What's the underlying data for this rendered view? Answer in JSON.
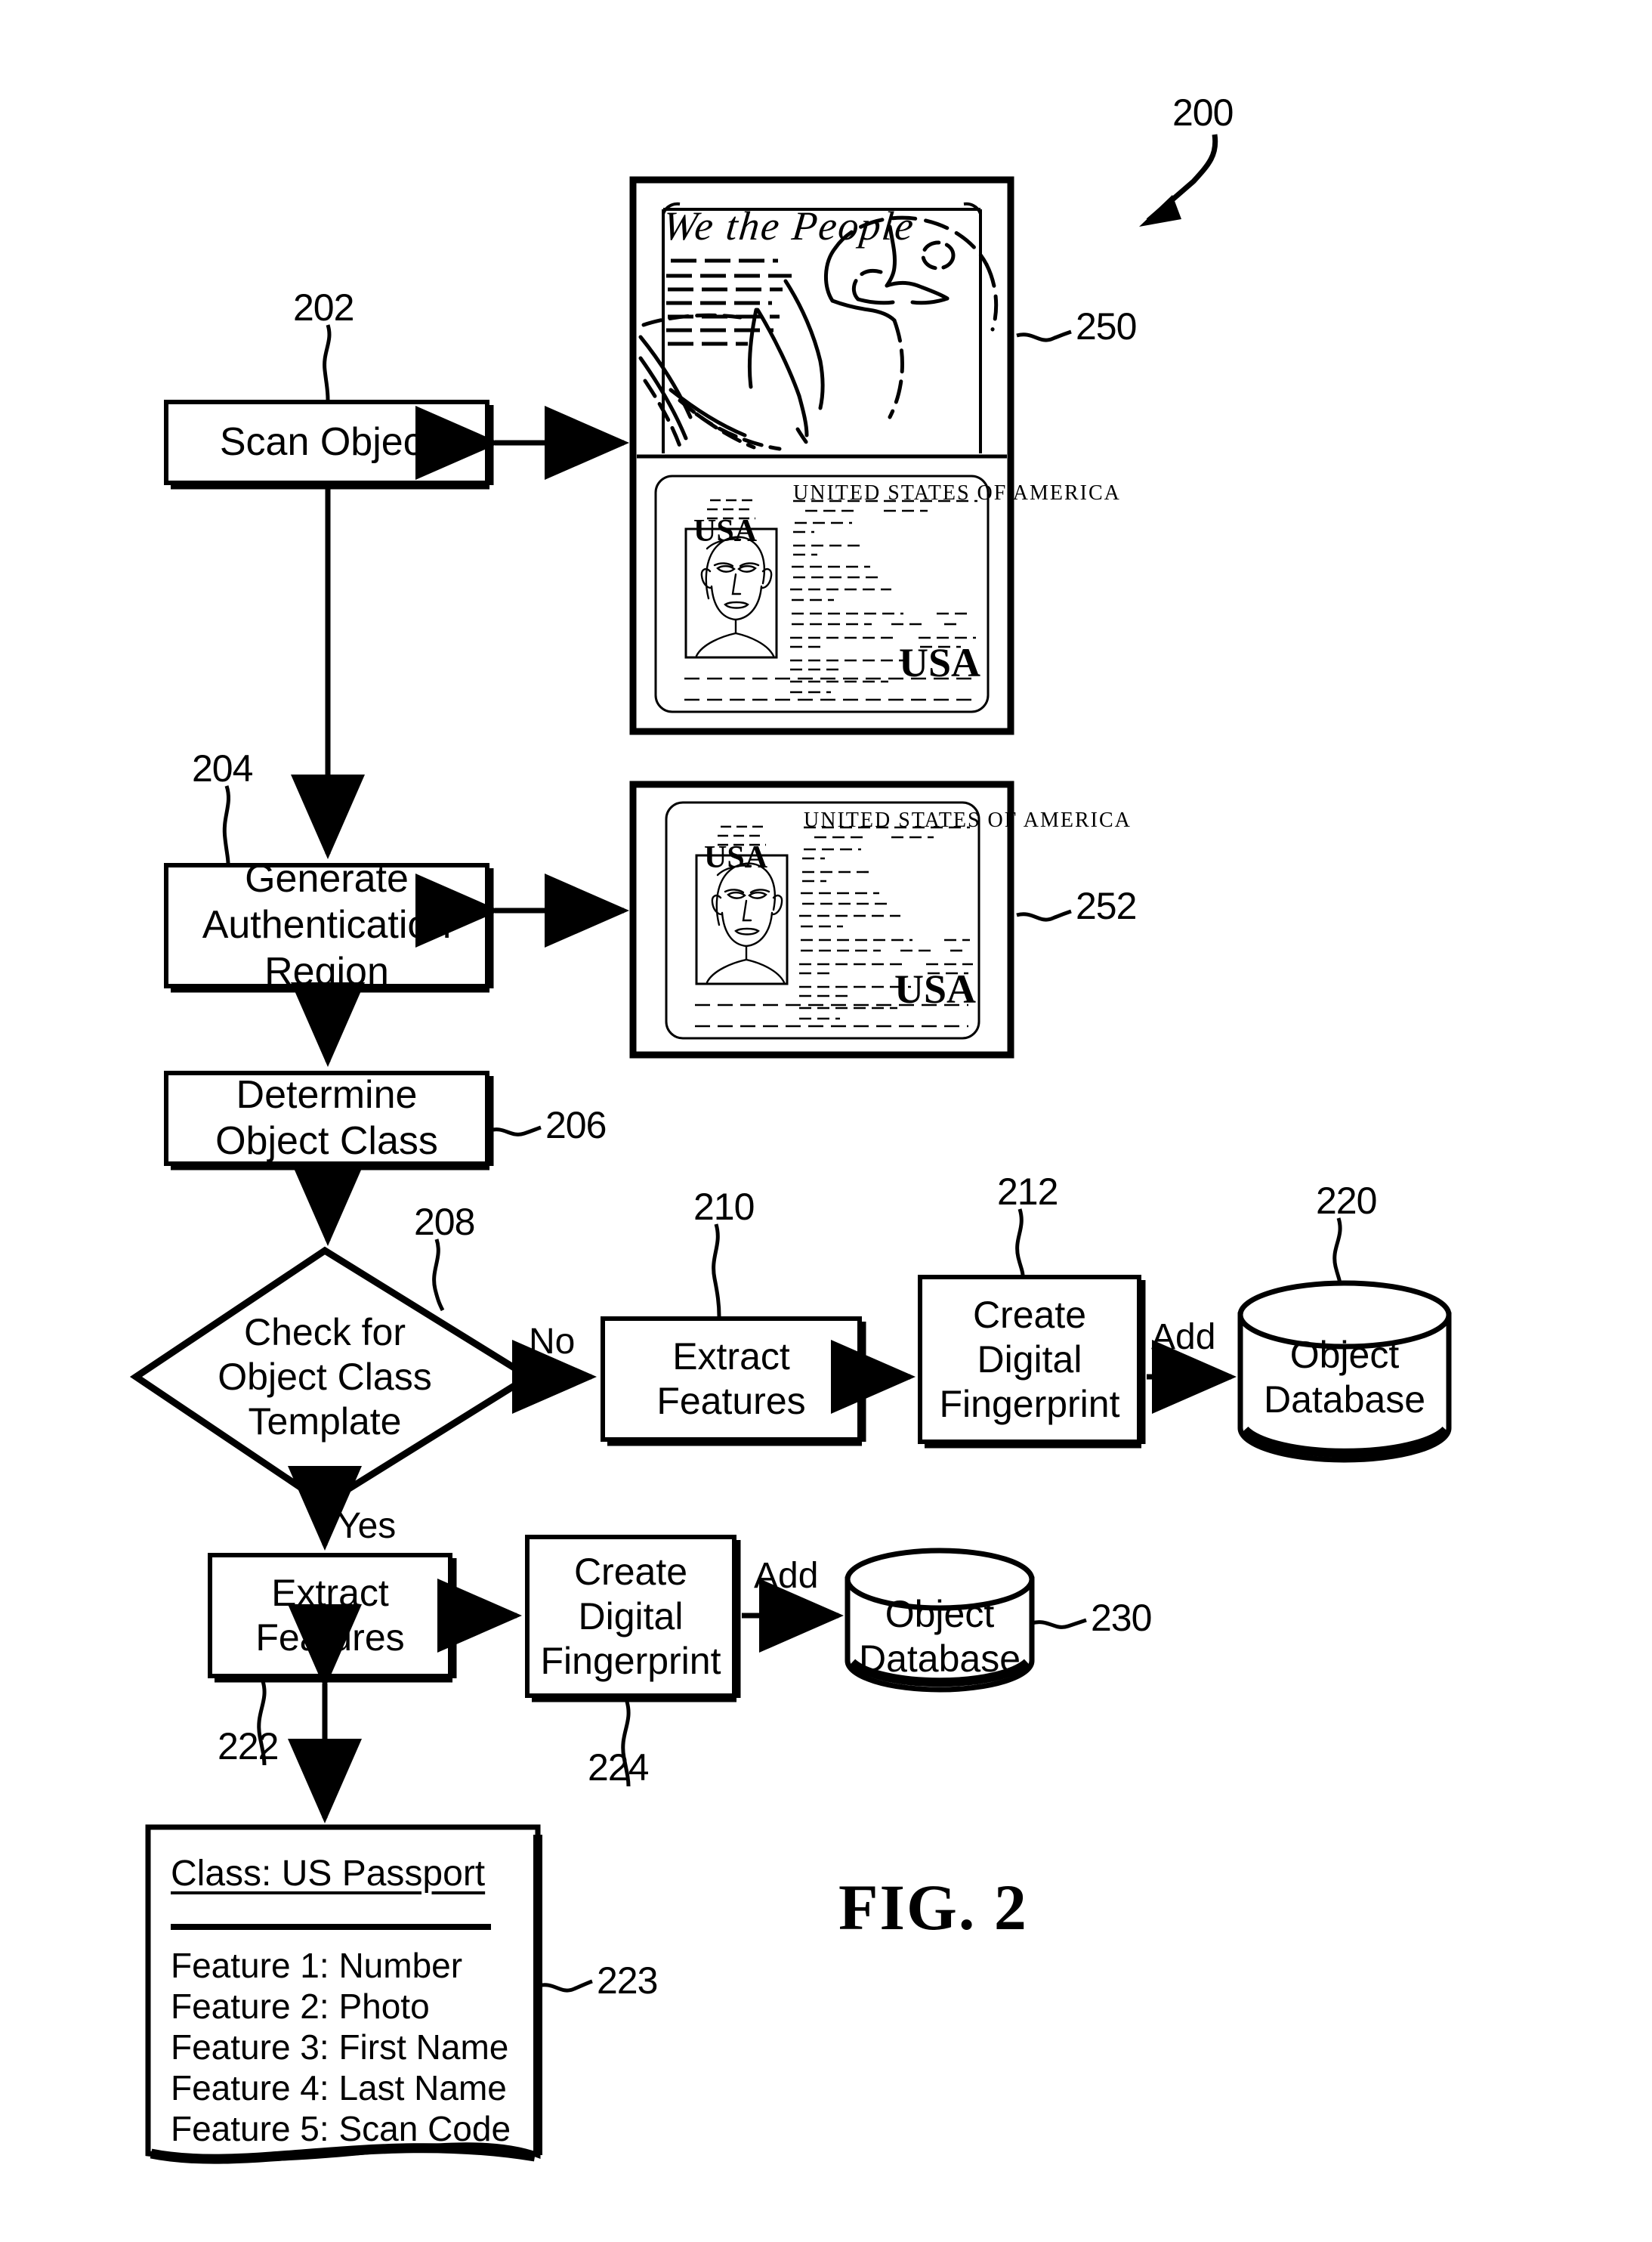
{
  "figure": {
    "label": "FIG. 2",
    "main_ref": "200"
  },
  "nodes": {
    "scan_object": {
      "label": "Scan Object",
      "ref": "202"
    },
    "generate_auth_region": {
      "label": "Generate\nAuthentication\nRegion",
      "ref": "204"
    },
    "determine_object_class": {
      "label": "Determine\nObject Class",
      "ref": "206"
    },
    "check_template": {
      "label": "Check for\nObject Class\nTemplate",
      "ref": "208"
    },
    "extract_features_no": {
      "label": "Extract\nFeatures",
      "ref": "210"
    },
    "create_fingerprint_no": {
      "label": "Create\nDigital\nFingerprint",
      "ref": "212"
    },
    "object_database_no": {
      "label": "Object\nDatabase",
      "ref": "220"
    },
    "extract_features_yes": {
      "label": "Extract\nFeatures",
      "ref": "222"
    },
    "create_fingerprint_yes": {
      "label": "Create\nDigital\nFingerprint",
      "ref": "224"
    },
    "object_database_yes": {
      "label": "Object\nDatabase",
      "ref": "230"
    },
    "class_template": {
      "ref": "223"
    }
  },
  "edges": {
    "no_label": "No",
    "yes_label": "Yes",
    "add_label_top": "Add",
    "add_label_bottom": "Add"
  },
  "class_template": {
    "title": "Class: US Passport",
    "features": [
      "Feature 1: Number",
      "Feature 2: Photo",
      "Feature 3: First Name",
      "Feature 4: Last Name",
      "Feature 5: Scan Code"
    ]
  },
  "scanned_object": {
    "ref": "250",
    "constitution": {
      "heading": "We the People"
    },
    "passport": {
      "country_caption": "UNITED STATES OF AMERICA",
      "code_left": "USA",
      "code_right": "USA"
    }
  },
  "authentication_region": {
    "ref": "252",
    "passport": {
      "country_caption": "UNITED STATES OF AMERICA",
      "code_left": "USA",
      "code_right": "USA"
    }
  }
}
